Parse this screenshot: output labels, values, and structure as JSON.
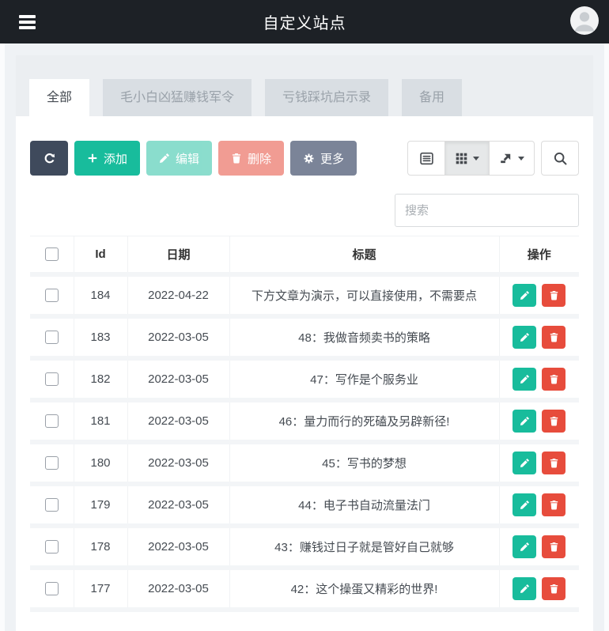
{
  "header": {
    "title": "自定义站点",
    "menu_icon": "hamburger-icon",
    "avatar_icon": "user-avatar-icon"
  },
  "tabs": [
    {
      "label": "全部",
      "active": true
    },
    {
      "label": "毛小白凶猛赚钱军令",
      "active": false
    },
    {
      "label": "亏钱踩坑启示录",
      "active": false
    },
    {
      "label": "备用",
      "active": false
    }
  ],
  "toolbar": {
    "refresh_icon": "refresh-icon",
    "add_label": "添加",
    "add_icon": "plus-icon",
    "edit_label": "编辑",
    "edit_icon": "pencil-icon",
    "delete_label": "删除",
    "delete_icon": "trash-icon",
    "more_label": "更多",
    "more_icon": "gear-icon"
  },
  "view_controls": [
    {
      "icon": "card-view-icon",
      "has_caret": false,
      "active": false
    },
    {
      "icon": "grid-columns-icon",
      "has_caret": true,
      "active": true
    },
    {
      "icon": "export-icon",
      "has_caret": true,
      "active": false
    },
    {
      "icon": "search-toggle-icon",
      "has_caret": false,
      "active": false
    }
  ],
  "search": {
    "placeholder": "搜索"
  },
  "table": {
    "columns": [
      "Id",
      "日期",
      "标题",
      "操作"
    ],
    "row_action_icons": [
      "pencil-icon",
      "trash-icon"
    ],
    "rows": [
      {
        "id": "184",
        "date": "2022-04-22",
        "title": "下方文章为演示，可以直接使用，不需要点"
      },
      {
        "id": "183",
        "date": "2022-03-05",
        "title": "48：我做音频卖书的策略"
      },
      {
        "id": "182",
        "date": "2022-03-05",
        "title": "47：写作是个服务业"
      },
      {
        "id": "181",
        "date": "2022-03-05",
        "title": "46：量力而行的死磕及另辟新径!"
      },
      {
        "id": "180",
        "date": "2022-03-05",
        "title": "45：写书的梦想"
      },
      {
        "id": "179",
        "date": "2022-03-05",
        "title": "44：电子书自动流量法门"
      },
      {
        "id": "178",
        "date": "2022-03-05",
        "title": "43：赚钱过日子就是管好自己就够"
      },
      {
        "id": "177",
        "date": "2022-03-05",
        "title": "42：这个操蛋又精彩的世界!"
      }
    ]
  },
  "colors": {
    "header_bg": "#1d2126",
    "page_bg": "#eff2f5",
    "accent_green": "#18bc9c",
    "danger_red": "#e74c3c",
    "primary_dark": "#3f4a5c",
    "more_gray": "#7b8498",
    "inactive_tab_bg": "#d9dee3"
  }
}
